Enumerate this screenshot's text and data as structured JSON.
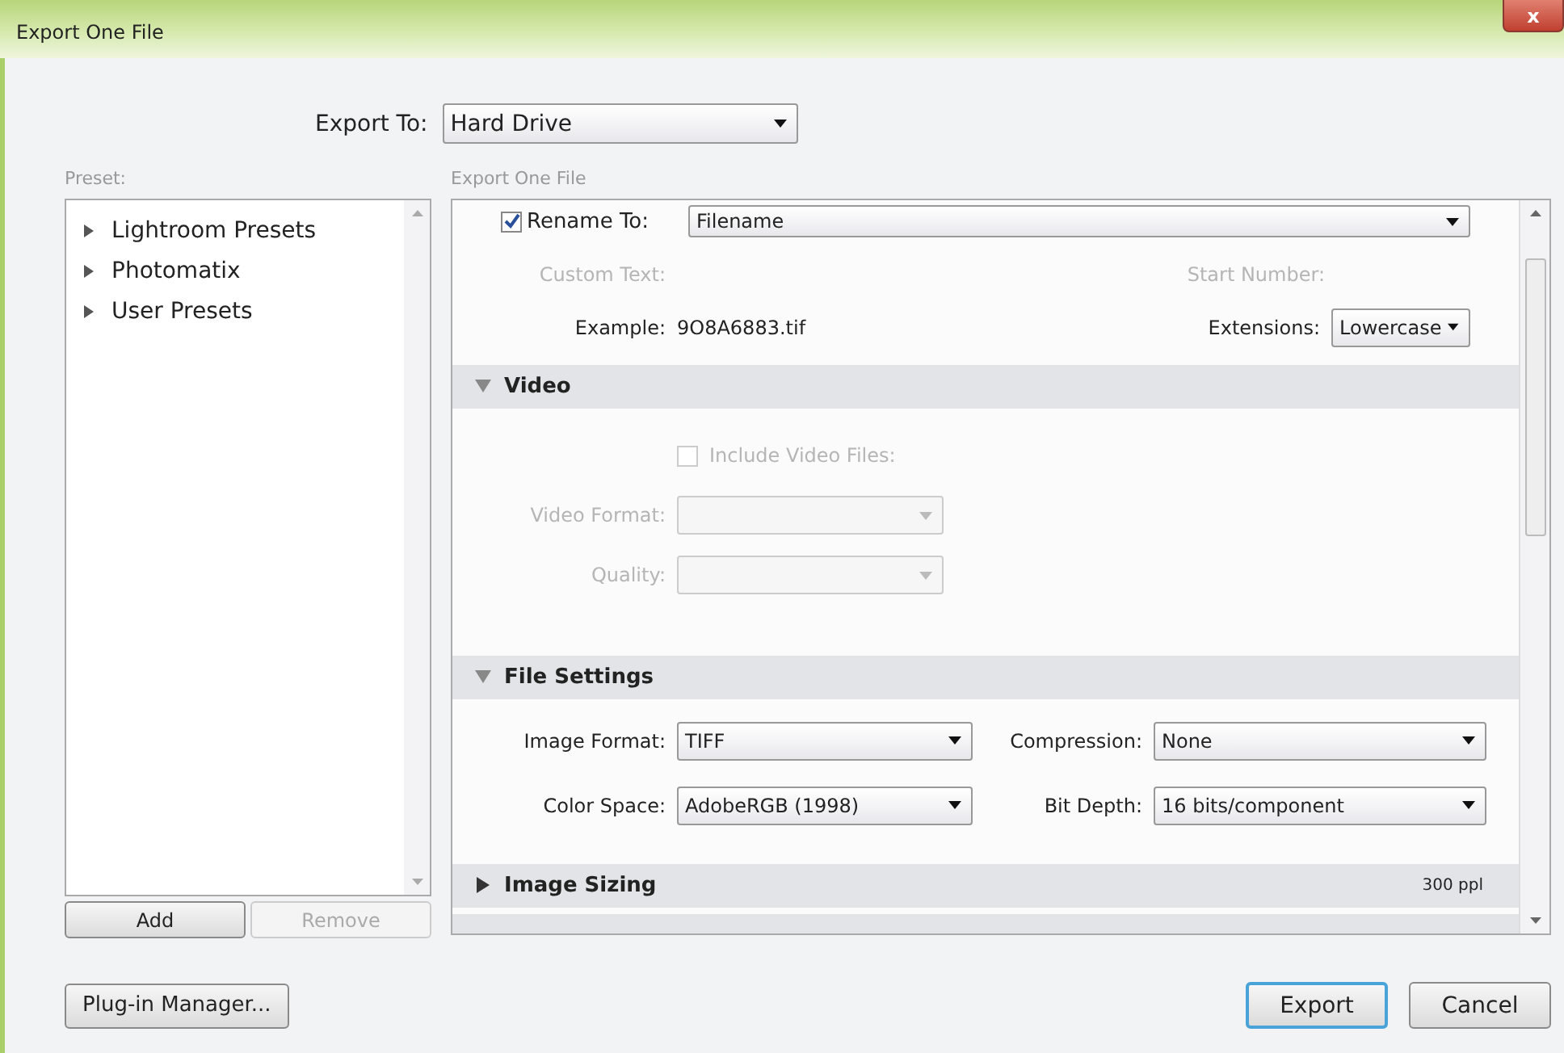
{
  "window": {
    "title": "Export One File",
    "close": "x"
  },
  "export_to": {
    "label": "Export To:",
    "value": "Hard Drive"
  },
  "preset_panel": {
    "label": "Preset:",
    "items": [
      {
        "label": "Lightroom Presets",
        "expanded": false
      },
      {
        "label": "Photomatix",
        "expanded": false
      },
      {
        "label": "User Presets",
        "expanded": false
      }
    ],
    "buttons": [
      {
        "label": "Add",
        "disabled": false
      },
      {
        "label": "Remove",
        "disabled": true
      }
    ]
  },
  "settings_panel": {
    "label": "Export One File",
    "rename": {
      "label": "Rename To:",
      "checked": true,
      "value": "Filename"
    },
    "custom_text_label": "Custom Text:",
    "start_number_label": "Start Number:",
    "example": {
      "label": "Example:",
      "value": "9O8A6883.tif"
    },
    "extensions": {
      "label": "Extensions:",
      "value": "Lowercase"
    },
    "sections": [
      {
        "title": "Video",
        "expanded": true,
        "kind": "stacked",
        "fields": [
          {
            "kind": "checkbox",
            "label": "Include Video Files:",
            "checked": false,
            "disabled": true
          },
          {
            "kind": "select",
            "label": "Video Format:",
            "disabled": true
          },
          {
            "kind": "select",
            "label": "Quality:",
            "disabled": true
          }
        ]
      },
      {
        "title": "File Settings",
        "expanded": true,
        "kind": "grid",
        "fields": [
          {
            "kind": "select",
            "label": "Image Format:",
            "value": "TIFF",
            "disabled": false
          },
          {
            "kind": "select",
            "label": "Compression:",
            "value": "None",
            "disabled": false
          },
          {
            "kind": "select",
            "label": "Color Space:",
            "value": "AdobeRGB (1998)",
            "disabled": false
          },
          {
            "kind": "select",
            "label": "Bit Depth:",
            "value": "16 bits/component",
            "disabled": false
          }
        ]
      },
      {
        "title": "Image Sizing",
        "expanded": false,
        "summary": "300 ppl"
      }
    ]
  },
  "footer": {
    "plugin_button": "Plug-in Manager...",
    "buttons": [
      {
        "label": "Export",
        "default": true
      },
      {
        "label": "Cancel",
        "default": false
      }
    ]
  }
}
